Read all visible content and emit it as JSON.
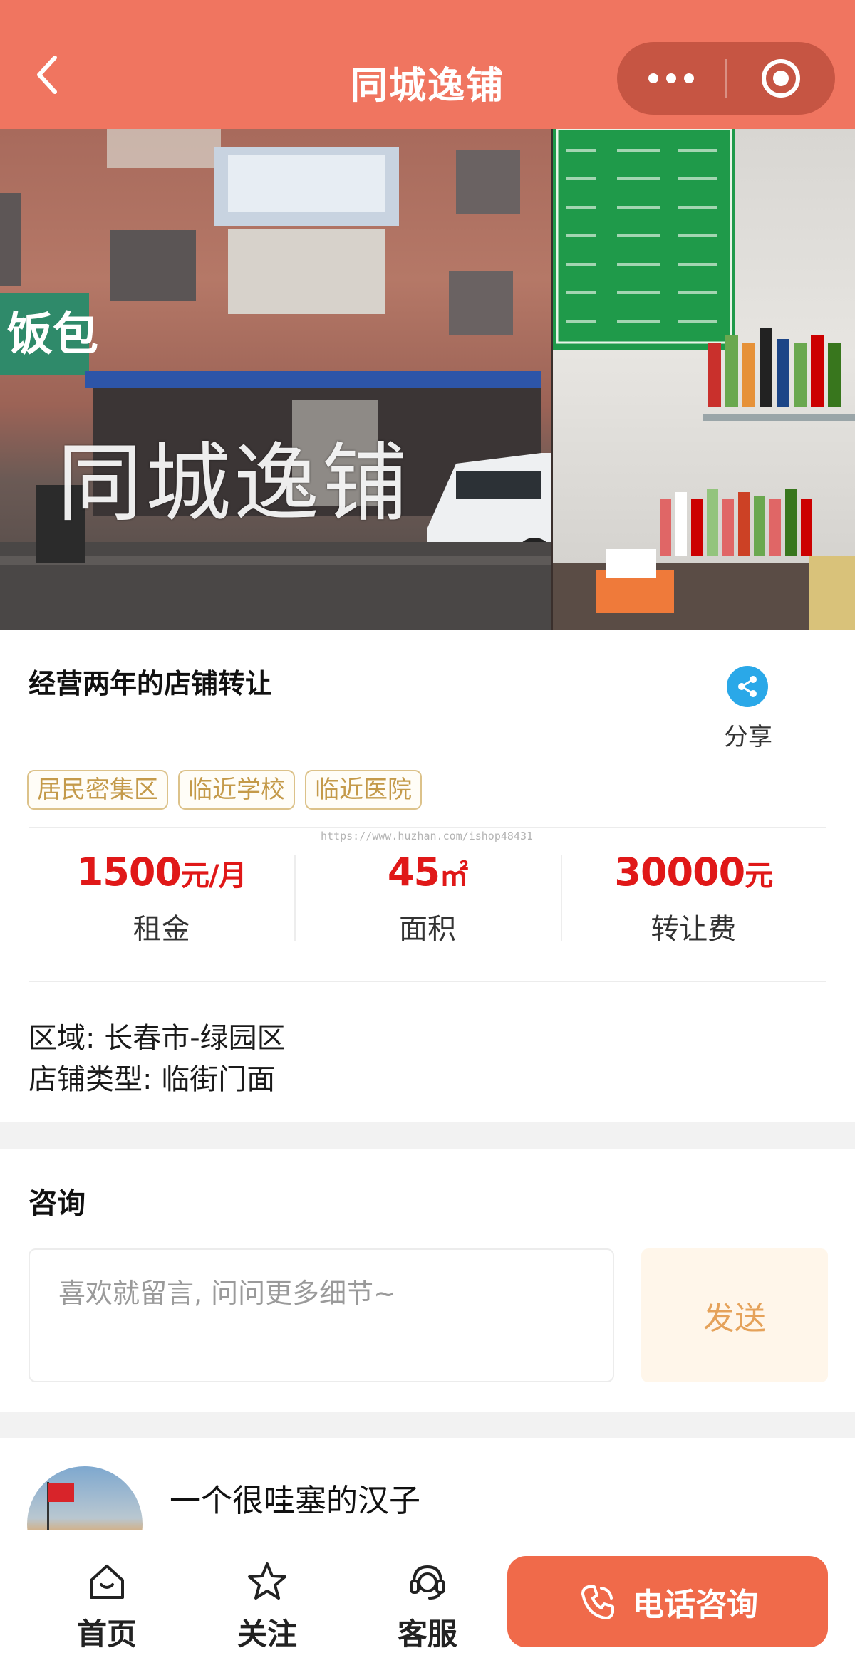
{
  "header": {
    "title": "同城逸铺",
    "icons": {
      "back": "back-chevron-icon",
      "more": "more-dots-icon",
      "close": "target-close-icon"
    }
  },
  "gallery": {
    "watermark": "同城逸铺",
    "photos": [
      "storefront-photo",
      "shop-interior-photo"
    ]
  },
  "listing": {
    "title": "经营两年的店铺转让",
    "share_label": "分享",
    "tags": [
      "居民密集区",
      "临近学校",
      "临近医院"
    ],
    "source_url": "https://www.huzhan.com/ishop48431",
    "stats": [
      {
        "value": "1500",
        "unit": "元/月",
        "label": "租金"
      },
      {
        "value": "45",
        "unit": "㎡",
        "label": "面积"
      },
      {
        "value": "30000",
        "unit": "元",
        "label": "转让费"
      }
    ],
    "region": "区域: 长春市-绿园区",
    "shop_type": "店铺类型: 临街门面"
  },
  "consult": {
    "title": "咨询",
    "placeholder": "喜欢就留言, 问问更多细节~",
    "send_label": "发送"
  },
  "user": {
    "name": "一个很哇塞的汉子"
  },
  "bottom_nav": {
    "home": "首页",
    "follow": "关注",
    "service": "客服",
    "call": "电话咨询"
  },
  "colors": {
    "header_bg": "#f07560",
    "price_red": "#e01818",
    "tag_gold": "#c49a4a",
    "share_blue": "#2aa8e8",
    "call_orange": "#f06a4a",
    "send_bg": "#fff6ea"
  }
}
